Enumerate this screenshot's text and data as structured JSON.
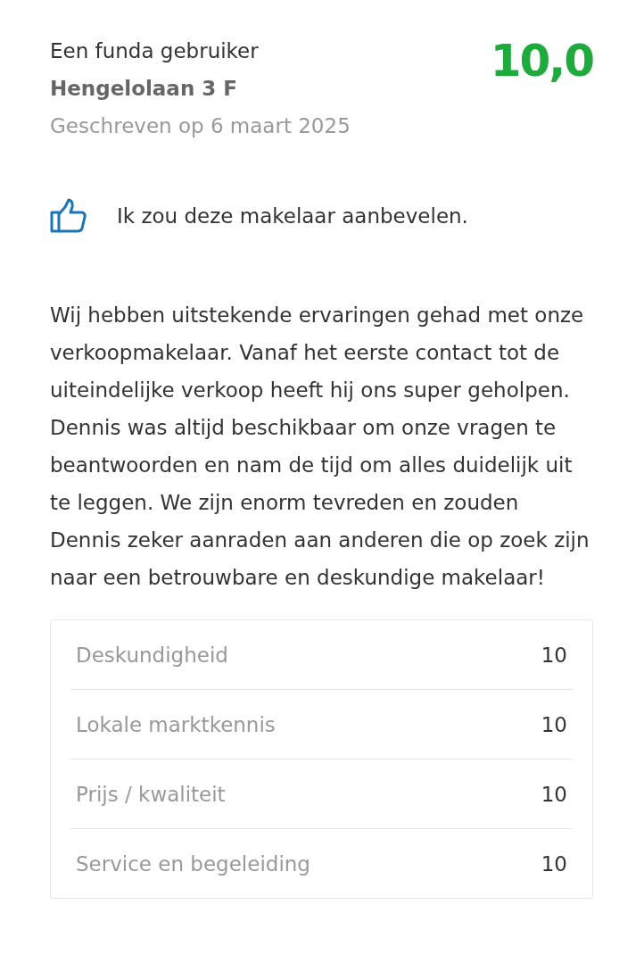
{
  "review": {
    "author": "Een funda gebruiker",
    "address": "Hengelolaan 3 F",
    "date": "Geschreven op 6 maart 2025",
    "score": "10,0"
  },
  "recommendation": {
    "recommended": true,
    "text": "Ik zou deze makelaar aanbevelen."
  },
  "body": "Wij hebben uitstekende ervaringen gehad met onze verkoopmakelaar. Vanaf het eerste contact tot de uiteindelijke verkoop heeft hij ons super geholpen. Dennis was altijd beschikbaar om onze vragen te beantwoorden en nam de tijd om alles duidelijk uit te leggen. We zijn enorm tevreden en zouden Dennis zeker aanraden aan anderen die op zoek zijn naar een betrouwbare en deskundige makelaar!",
  "ratings": [
    {
      "label": "Deskundigheid",
      "value": "10"
    },
    {
      "label": "Lokale marktkennis",
      "value": "10"
    },
    {
      "label": "Prijs / kwaliteit",
      "value": "10"
    },
    {
      "label": "Service en begeleiding",
      "value": "10"
    }
  ]
}
